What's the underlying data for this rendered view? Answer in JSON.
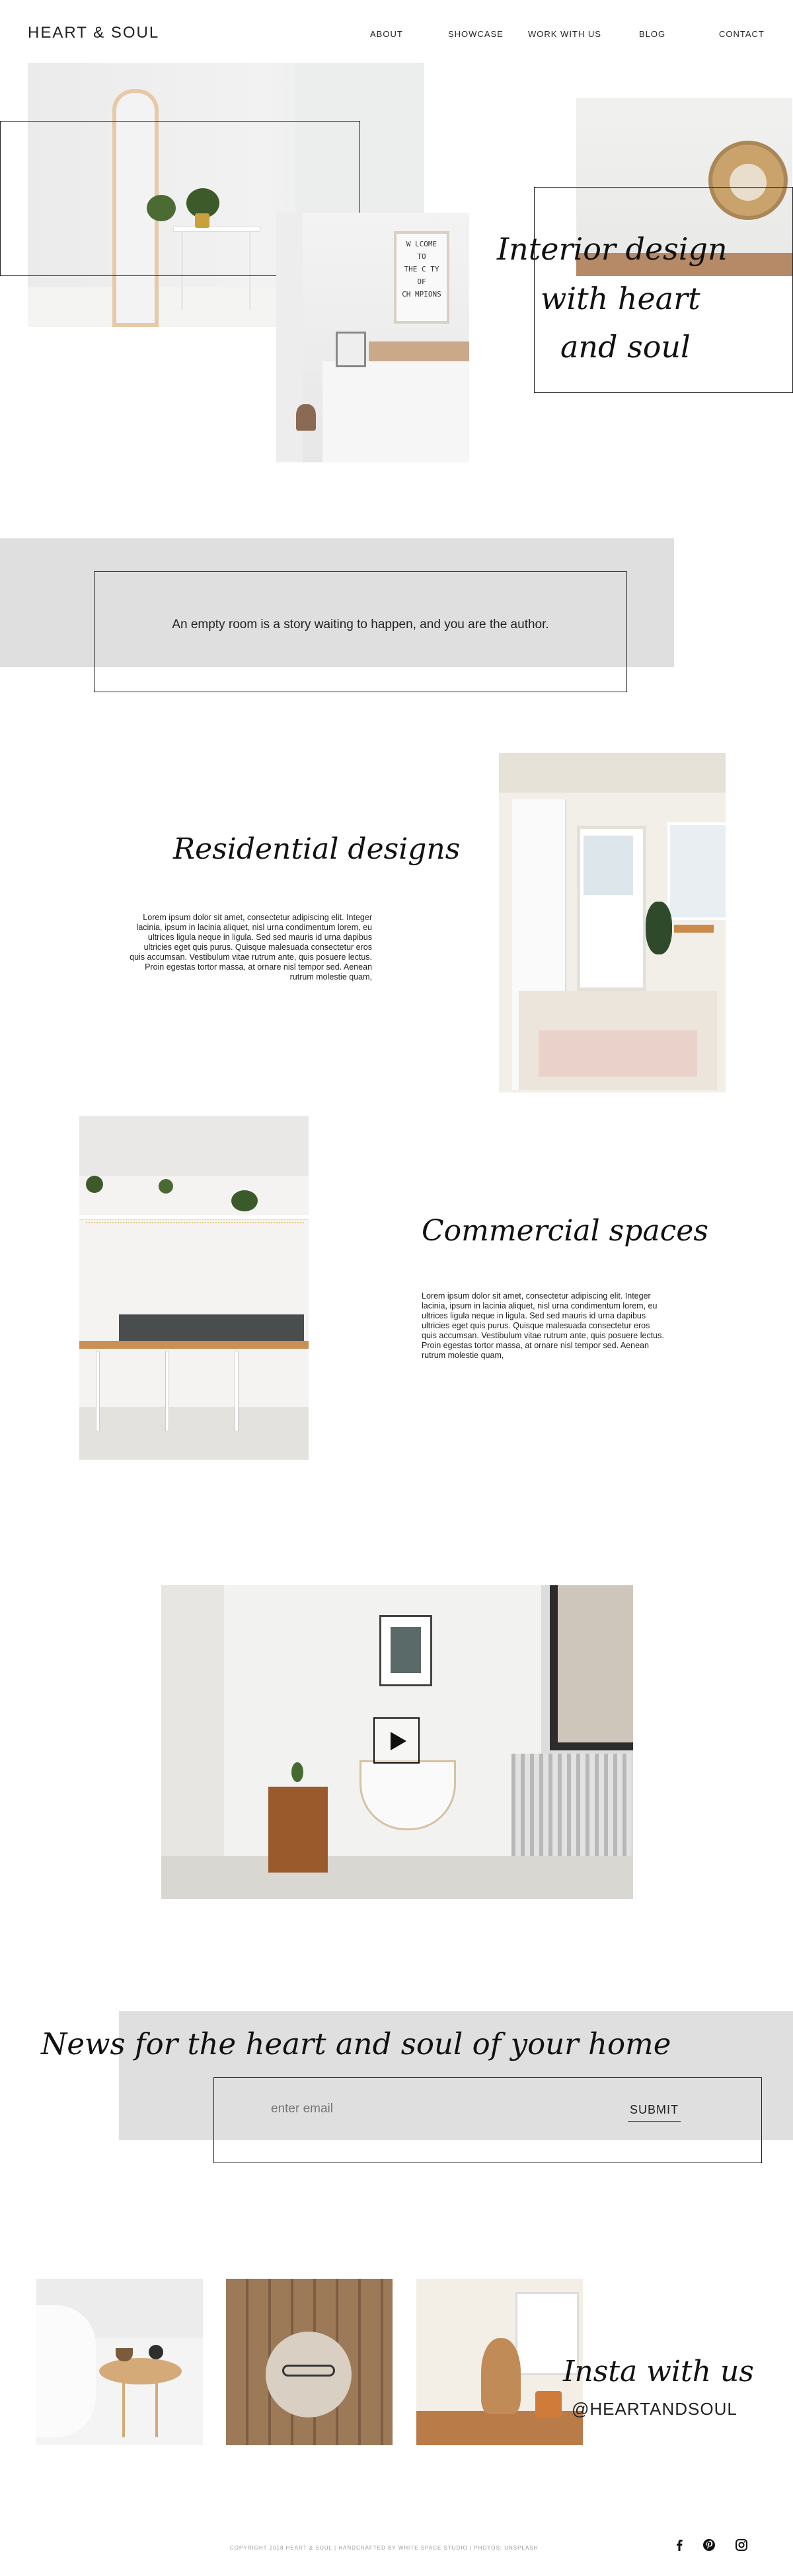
{
  "header": {
    "logo": "HEART & SOUL",
    "nav": [
      "ABOUT",
      "SHOWCASE",
      "WORK WITH US",
      "BLOG",
      "CONTACT"
    ]
  },
  "hero": {
    "script_lines": [
      "Interior design",
      "with heart",
      "and soul"
    ],
    "sign_lines": [
      "W LCOME",
      "TO",
      "THE C TY",
      "OF",
      "CH MPIONS"
    ]
  },
  "quote": {
    "text": "An empty room is a story waiting to happen, and you are the author."
  },
  "residential": {
    "title": "Residential designs",
    "body": "Lorem ipsum dolor sit amet, consectetur adipiscing elit. Integer lacinia, ipsum in lacinia aliquet, nisl urna condimentum lorem, eu ultrices ligula neque in ligula. Sed sed mauris id urna dapibus ultricies eget quis purus. Quisque malesuada consectetur eros quis accumsan. Vestibulum vitae rutrum ante, quis posuere lectus. Proin egestas tortor massa, at ornare nisl tempor sed. Aenean rutrum molestie quam,"
  },
  "commercial": {
    "title": "Commercial spaces",
    "body": "Lorem ipsum dolor sit amet, consectetur adipiscing elit. Integer lacinia, ipsum in lacinia aliquet, nisl urna condimentum lorem, eu ultrices ligula neque in ligula. Sed sed mauris id urna dapibus ultricies eget quis purus. Quisque malesuada consectetur eros quis accumsan. Vestibulum vitae rutrum ante, quis posuere lectus. Proin egestas tortor massa, at ornare nisl tempor sed. Aenean rutrum molestie quam,"
  },
  "newsletter": {
    "title": "News for the heart and soul of your home",
    "email_placeholder": "enter email",
    "submit_label": "SUBMIT"
  },
  "insta": {
    "script": "Insta with us",
    "handle": "@HEARTANDSOUL"
  },
  "footer": {
    "copyright": "COPYRIGHT 2018 HEART & SOUL | HANDCRAFTED BY WHITE SPACE STUDIO | PHOTOS: UNSPLASH",
    "social_icons": [
      "facebook-icon",
      "pinterest-icon",
      "instagram-icon"
    ]
  }
}
